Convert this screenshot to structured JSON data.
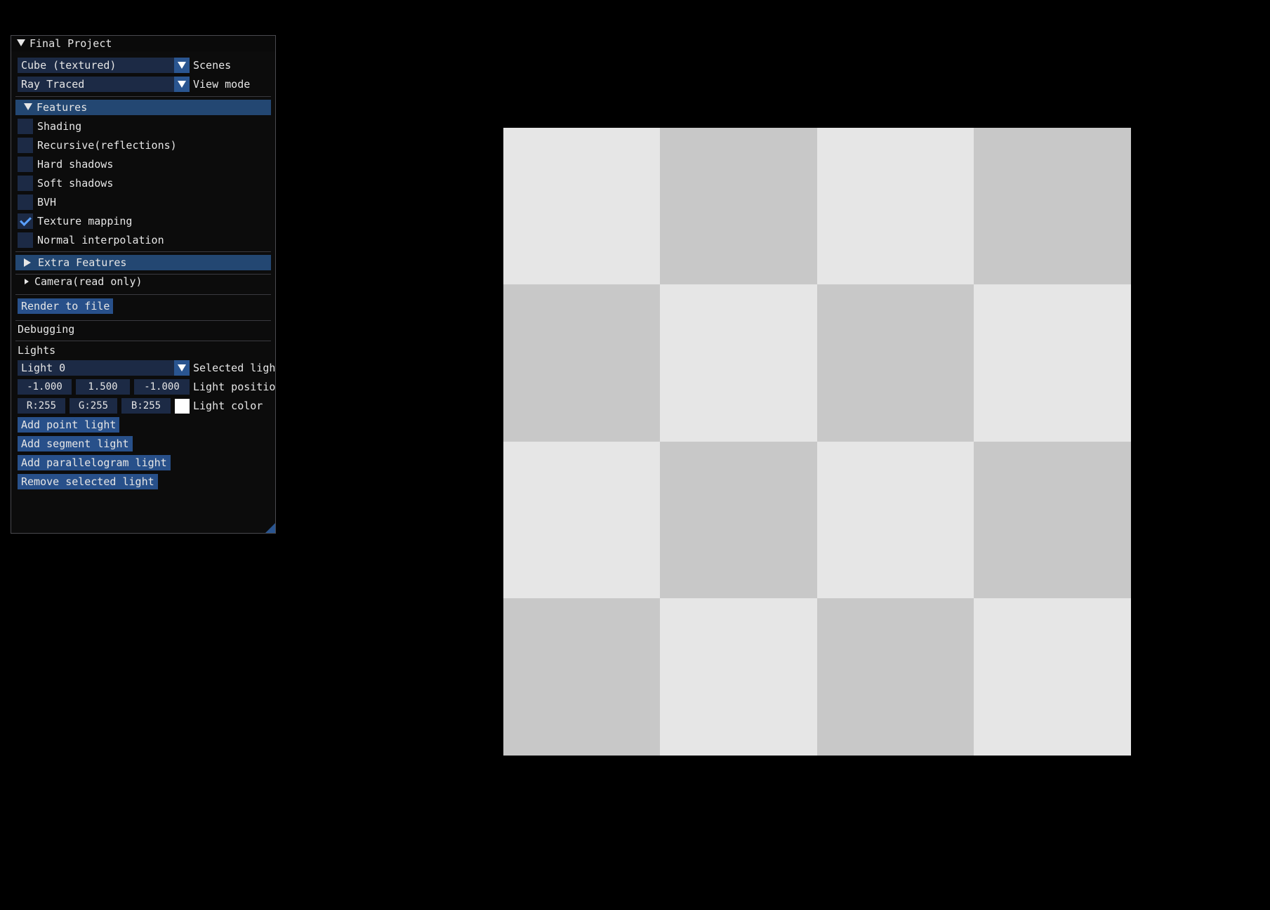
{
  "window": {
    "title": "Final Project",
    "scene_combo": {
      "value": "Cube (textured)",
      "label": "Scenes"
    },
    "view_combo": {
      "value": "Ray Traced",
      "label": "View mode"
    },
    "features_header": "Features",
    "features": [
      {
        "label": "Shading",
        "checked": false
      },
      {
        "label": "Recursive(reflections)",
        "checked": false
      },
      {
        "label": "Hard shadows",
        "checked": false
      },
      {
        "label": "Soft shadows",
        "checked": false
      },
      {
        "label": "BVH",
        "checked": false
      },
      {
        "label": "Texture mapping",
        "checked": true
      },
      {
        "label": "Normal interpolation",
        "checked": false
      }
    ],
    "extra_features_header": "Extra Features",
    "camera_node": "Camera(read only)",
    "render_button": "Render to file",
    "debugging_label": "Debugging",
    "lights_label": "Lights",
    "light_combo": {
      "value": "Light 0",
      "label": "Selected ligh"
    },
    "light_position": {
      "x": "-1.000",
      "y": "1.500",
      "z": "-1.000",
      "label": "Light positio"
    },
    "light_color": {
      "r": "R:255",
      "g": "G:255",
      "b": "B:255",
      "label": "Light color",
      "swatch": "#ffffff"
    },
    "buttons": {
      "add_point": "Add point light",
      "add_segment": "Add segment light",
      "add_parallelogram": "Add parallelogram light",
      "remove_selected": "Remove selected light"
    }
  },
  "viewport": {
    "texture": "checkerboard",
    "rows": 4,
    "cols": 4,
    "light_color": "#e6e6e6",
    "dark_color": "#c8c8c8"
  },
  "colors": {
    "accent": "#234772",
    "button": "#28508a",
    "frame_bg": "#1c2a45",
    "check": "#5aa0ff"
  }
}
